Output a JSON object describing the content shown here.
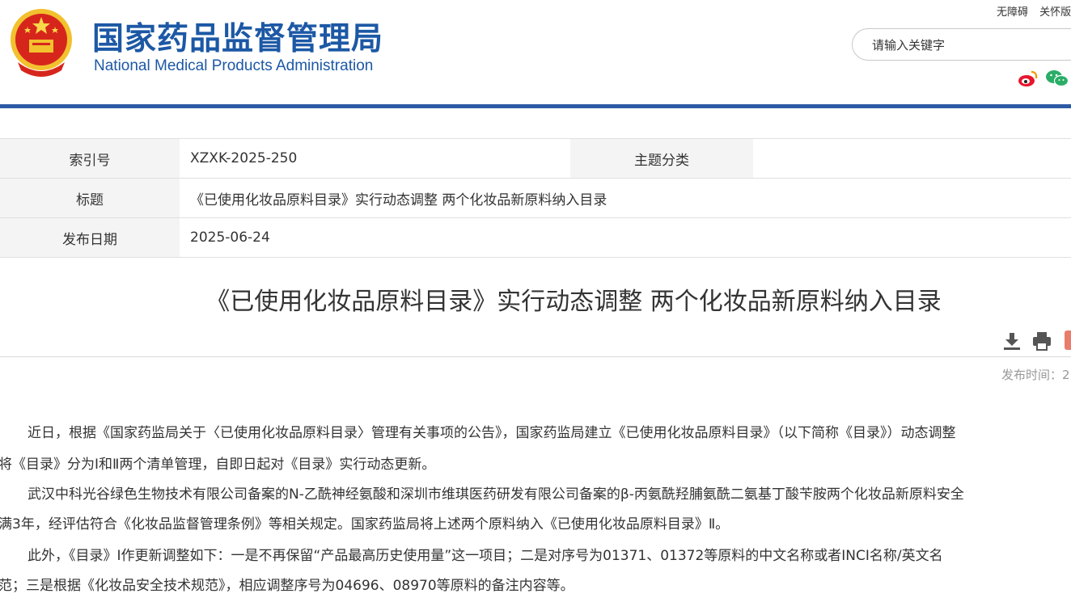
{
  "header": {
    "org_cn": "国家药品监督管理局",
    "org_en": "National Medical Products Administration",
    "links": [
      "无障碍",
      "关怀版"
    ],
    "search_placeholder": "请输入关键字",
    "social": [
      "weibo-icon",
      "wechat-icon"
    ],
    "accent_color": "#2c5aa5"
  },
  "info": {
    "index_label": "索引号",
    "index_value": "XZXK-2025-250",
    "topic_label": "主题分类",
    "topic_value": "",
    "title_label": "标题",
    "title_value": "《已使用化妆品原料目录》实行动态调整 两个化妆品新原料纳入目录",
    "date_label": "发布日期",
    "date_value": "2025-06-24"
  },
  "article": {
    "title": "《已使用化妆品原料目录》实行动态调整 两个化妆品新原料纳入目录",
    "pub_time_label": "发布时间：2",
    "tools": [
      "download-icon",
      "print-icon"
    ],
    "paragraphs": [
      "近日，根据《国家药监局关于〈已使用化妆品原料目录〉管理有关事项的公告》，国家药监局建立《已使用化妆品原料目录》（以下简称《目录》）动态调整",
      "将《目录》分为Ⅰ和Ⅱ两个清单管理，自即日起对《目录》实行动态更新。",
      "武汉中科光谷绿色生物技术有限公司备案的N-乙酰神经氨酸和深圳市维琪医药研发有限公司备案的β-丙氨酰羟脯氨酰二氨基丁酸苄胺两个化妆品新原料安全",
      "满3年，经评估符合《化妆品监督管理条例》等相关规定。国家药监局将上述两个原料纳入《已使用化妆品原料目录》Ⅱ。",
      "此外，《目录》Ⅰ作更新调整如下：一是不再保留“产品最高历史使用量”这一项目；二是对序号为01371、01372等原料的中文名称或者INCI名称/英文名",
      "范；三是根据《化妆品安全技术规范》，相应调整序号为04696、08970等原料的备注内容等。"
    ]
  }
}
